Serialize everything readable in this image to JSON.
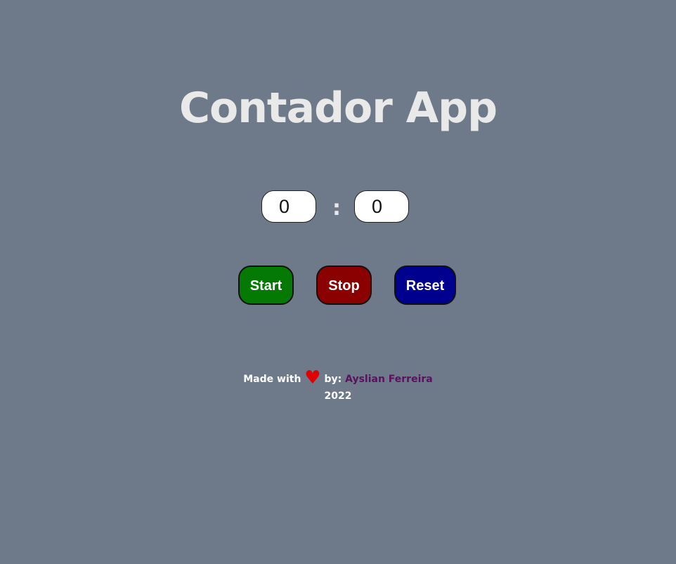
{
  "app": {
    "title": "Contador App"
  },
  "counter": {
    "minutes": "0",
    "separator": ":",
    "seconds": "0"
  },
  "buttons": {
    "start": "Start",
    "stop": "Stop",
    "reset": "Reset"
  },
  "footer": {
    "made_with": "Made with",
    "heart": "♥",
    "by": "by:",
    "author": "Ayslian Ferreira",
    "year": "2022"
  },
  "colors": {
    "background": "#6e7a89",
    "start": "#047a04",
    "stop": "#8b0101",
    "reset": "#00008f",
    "heart": "#e00000",
    "author_link": "#5c1060"
  },
  "icons": {
    "heart": "heart-icon"
  }
}
